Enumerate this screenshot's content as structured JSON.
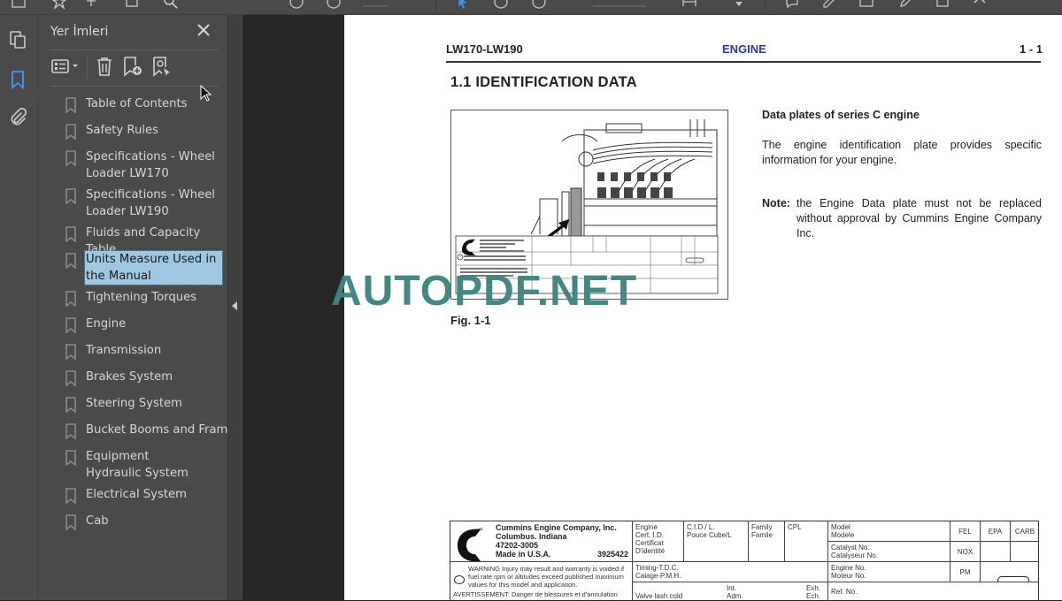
{
  "toolbar": {
    "icons": [
      "page-view-icon",
      "bookmark-star-icon",
      "upload-icon",
      "print-icon",
      "search-icon",
      "zoom-out-icon",
      "zoom-in-icon",
      "select-cursor-icon",
      "hand-icon",
      "fit-page-icon",
      "scroll-icon",
      "comment-icon",
      "highlight-icon",
      "fill-sign-icon",
      "edit-icon",
      "stamp-icon",
      "share-icon"
    ]
  },
  "leftrail": {
    "items": [
      {
        "name": "pages-thumbnails",
        "icon": "copy-pages-icon",
        "active": false
      },
      {
        "name": "bookmarks",
        "icon": "bookmark-icon",
        "active": true
      },
      {
        "name": "attachments",
        "icon": "paperclip-icon",
        "active": false
      }
    ],
    "active_color": "#3d8ff0"
  },
  "panel": {
    "title": "Yer İmleri",
    "tools": [
      "options-menu-icon",
      "delete-bookmark-icon",
      "add-bookmark-icon",
      "find-bookmark-icon"
    ],
    "bookmarks": [
      {
        "label": "Table of Contents",
        "selected": false
      },
      {
        "label": "Safety Rules",
        "selected": false
      },
      {
        "label": "Specifications - Wheel Loader LW170",
        "selected": false
      },
      {
        "label": "Specifications - Wheel Loader LW190",
        "selected": false
      },
      {
        "label": "Fluids and Capacity Table",
        "selected": false
      },
      {
        "label": "Units Measure Used in the Manual",
        "selected": true
      },
      {
        "label": "Tightening Torques",
        "selected": false
      },
      {
        "label": "Engine",
        "selected": false
      },
      {
        "label": "Transmission",
        "selected": false
      },
      {
        "label": "Brakes System",
        "selected": false
      },
      {
        "label": "Steering System",
        "selected": false
      },
      {
        "label": "Bucket Booms and Frame",
        "selected": false
      },
      {
        "label": "Equipment Hydraulic System",
        "selected": false
      },
      {
        "label": "Electrical System",
        "selected": false
      },
      {
        "label": "Cab",
        "selected": false
      }
    ],
    "selected_bg": "#9ec7e2"
  },
  "document": {
    "header": {
      "left": "LW170-LW190",
      "center": "ENGINE",
      "right": "1 - 1",
      "center_color": "#2b3a9a"
    },
    "section_title": "1.1  IDENTIFICATION DATA",
    "figure_caption": "Fig. 1-1",
    "right_column": {
      "heading": "Data plates of series C engine",
      "paragraph": "The engine identification plate provides specific information for your engine.",
      "note_label": "Note",
      "note_text": "the Engine Data plate must not be replaced without approval by Cummins Engine Company Inc."
    },
    "plate": {
      "brand": "Cummins",
      "company_lines": [
        "Cummins Engine Company, Inc.",
        "Columbus. Indiana",
        "47202-3005",
        "Made in U.S.A."
      ],
      "part_number": "3925422",
      "engine_cert": "Engine\nCert. I.D.\nCertificat\nD'identité",
      "cid": "C.I.D./ L.\nPouce Cube/L",
      "family": "Family\nFamile",
      "cpl": "CPL",
      "model": "Model\nModele",
      "fel": "FEL",
      "epa": "EPA",
      "carb": "CARB",
      "catalyst": "Catalyst No.\nCatalyseur No.",
      "nox": "NOX",
      "engine_no": "Engine No.\nMoteur No.",
      "pm": "PM",
      "warning": "WARNING Injury may result and warranty is voided if fuel rate rpm or altitudes exceed published maximum values for this model and application.",
      "avertissement": "AVERTISSEMENT: Danger de blessures et d'annulation",
      "timing": "Timing-T.D.C.\nCalage-P.M.H.",
      "valve_lash": "Valve lash cold\nJeux Soup.à Froid",
      "int": "Int.\nAdm.",
      "exh": "Exh.\nEch.",
      "ref_no": "Ref. No."
    },
    "watermark": "AUTOPDF.NET",
    "watermark_color": "#3e8580"
  }
}
